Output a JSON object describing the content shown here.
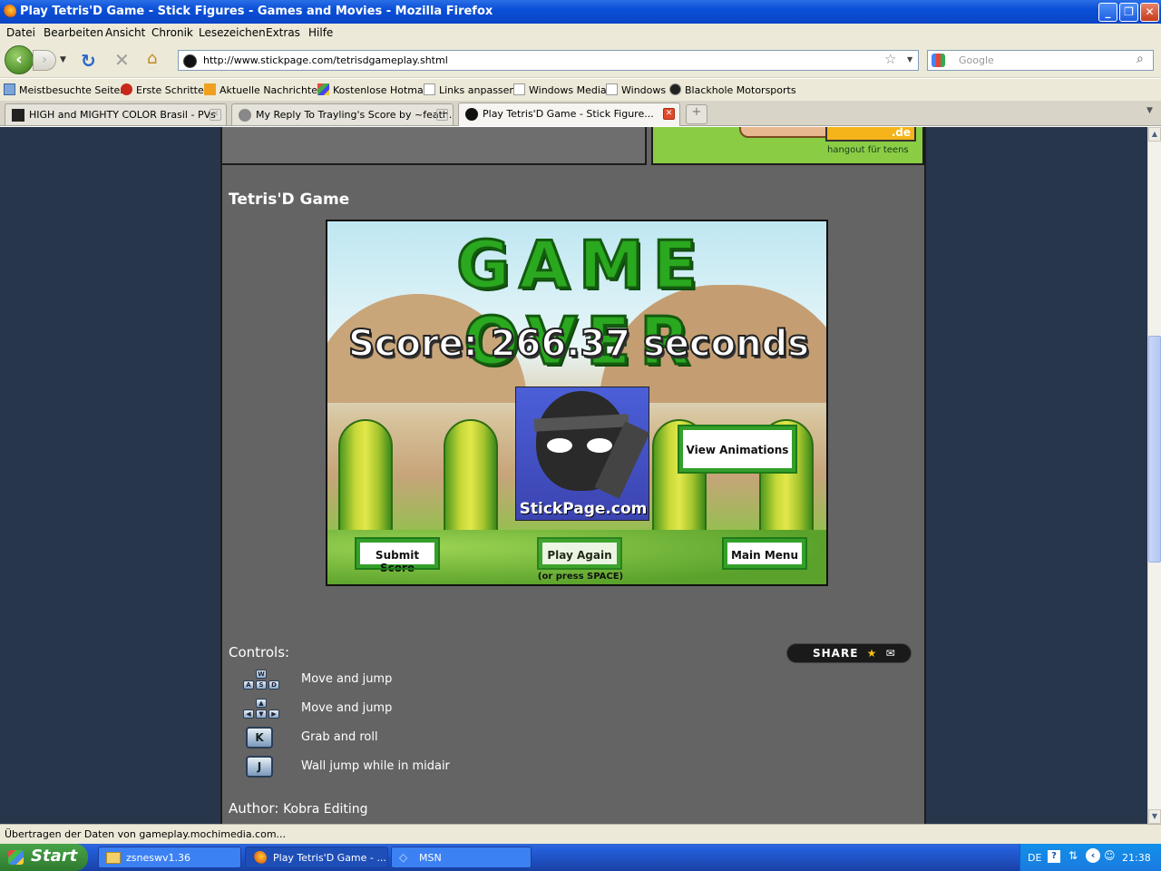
{
  "window": {
    "title": "Play Tetris'D Game - Stick Figures - Games and Movies - Mozilla Firefox"
  },
  "menu": [
    "Datei",
    "Bearbeiten",
    "Ansicht",
    "Chronik",
    "Lesezeichen",
    "Extras",
    "Hilfe"
  ],
  "nav": {
    "url": "http://www.stickpage.com/tetrisdgameplay.shtml",
    "search_placeholder": "Google"
  },
  "bookmarks": [
    "Meistbesuchte Seiten",
    "Erste Schritte",
    "Aktuelle Nachrichten",
    "Kostenlose Hotmail",
    "Links anpassen",
    "Windows Media",
    "Windows",
    "Blackhole Motorsports"
  ],
  "tabs": [
    {
      "label": "HIGH and MIGHTY COLOR Brasil - PVs"
    },
    {
      "label": "My Reply To Trayling's Score by ~feath..."
    },
    {
      "label": "Play Tetris'D Game - Stick Figure..."
    }
  ],
  "ad": {
    "brand": ".de",
    "tagline": "hangout für teens"
  },
  "page": {
    "game_title": "Tetris'D Game",
    "game": {
      "headline": "GAME OVER",
      "score": "Score: 266.37 seconds",
      "view_animations": "View Animations",
      "logo": "StickPage.com",
      "submit_score": "Submit Score",
      "play_again": "Play Again",
      "play_again_hint": "(or press SPACE)",
      "main_menu": "Main Menu"
    },
    "controls_heading": "Controls:",
    "share_label": "SHARE",
    "controls": [
      {
        "key": "WASD",
        "label": "Move and jump"
      },
      {
        "key": "arrows",
        "label": "Move and jump"
      },
      {
        "key": "K",
        "label": "Grab and roll"
      },
      {
        "key": "J",
        "label": "Wall jump while in midair"
      }
    ],
    "author_label": "Author:",
    "author_name": "Kobra Editing"
  },
  "status": {
    "text": "Übertragen der Daten von gameplay.mochimedia.com..."
  },
  "taskbar": {
    "start": "Start",
    "tasks": [
      "zsneswv1.36",
      "Play Tetris'D Game - ...",
      "MSN"
    ],
    "lang": "DE",
    "clock": "21:38"
  }
}
